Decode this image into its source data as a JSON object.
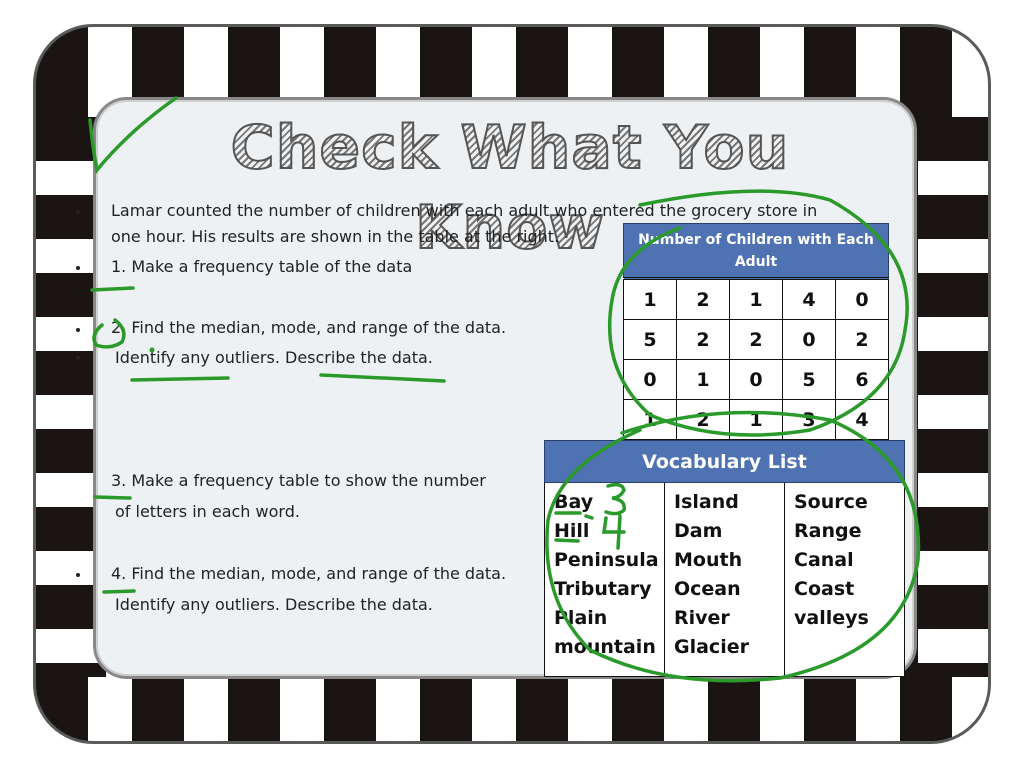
{
  "page": {
    "title": "Check What You Know",
    "intro_line1": "Lamar counted the number of children with each adult who entered the grocery store in",
    "intro_line2": "one hour.  His results are shown in the table at the right.",
    "tasks": [
      {
        "line1": "1.  Make a frequency table of the data"
      },
      {
        "line1": "2.  Find the median, mode, and range of the data.",
        "line2": "Identify any outliers.   Describe the data."
      },
      {
        "line1": "3.  Make a frequency table to show the number",
        "line2": "of letters in each word."
      },
      {
        "line1": "4. Find the median, mode, and range of the data.",
        "line2": "Identify any outliers.   Describe the data."
      }
    ]
  },
  "children_table": {
    "header": "Number of Children with Each Adult",
    "rows": [
      [
        "1",
        "2",
        "1",
        "4",
        "0"
      ],
      [
        "5",
        "2",
        "2",
        "0",
        "2"
      ],
      [
        "0",
        "1",
        "0",
        "5",
        "6"
      ],
      [
        "1",
        "2",
        "1",
        "3",
        "4"
      ]
    ]
  },
  "vocab_table": {
    "header": "Vocabulary List",
    "columns": [
      [
        "Bay",
        "Hill",
        "Peninsula",
        "Tributary",
        "Plain",
        "mountain"
      ],
      [
        "Island",
        "Dam",
        "Mouth",
        "Ocean",
        "River",
        "Glacier"
      ],
      [
        "Source",
        "Range",
        "Canal",
        "Coast",
        "valleys"
      ]
    ]
  },
  "annotations": {
    "ink_color": "#2a9a2a",
    "handwritten_numbers": [
      "3",
      "4"
    ]
  },
  "colors": {
    "table_header": "#4f72b2",
    "board": "#eef1f4",
    "frame_dark": "#1a1413"
  }
}
